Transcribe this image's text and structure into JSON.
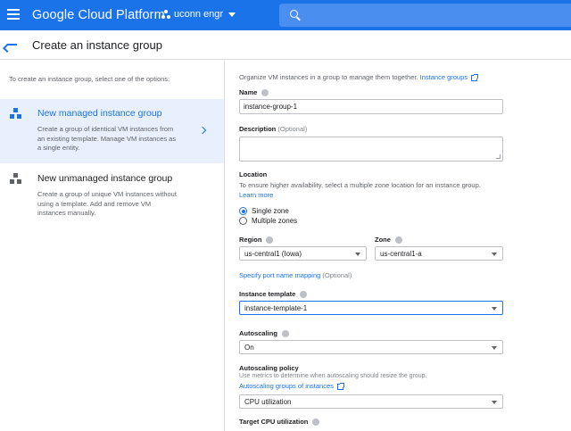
{
  "topbar": {
    "brand": "Google Cloud Platform",
    "project": "uconn engr",
    "search_placeholder": ""
  },
  "header": {
    "title": "Create an instance group"
  },
  "left": {
    "intro": "To create an instance group, select one of the options:",
    "options": [
      {
        "title": "New managed instance group",
        "description": "Create a group of identical VM instances from an existing template. Manage VM instances as a single entity."
      },
      {
        "title": "New unmanaged instance group",
        "description": "Create a group of unique VM instances without using a template. Add and remove VM instances manually."
      }
    ]
  },
  "form": {
    "intro": "Organize VM instances in a group to manage them together.",
    "intro_link": "Instance groups",
    "name_label": "Name",
    "name_value": "instance-group-1",
    "description_label": "Description",
    "description_optional": "(Optional)",
    "location_label": "Location",
    "location_help": "To ensure higher availability, select a multiple zone location for an instance group.",
    "learn_more": "Learn more",
    "single_zone": "Single zone",
    "multiple_zones": "Multiple zones",
    "region_label": "Region",
    "region_value": "us-central1 (Iowa)",
    "zone_label": "Zone",
    "zone_value": "us-central1-a",
    "port_mapping": "Specify port name mapping",
    "port_optional": "(Optional)",
    "template_label": "Instance template",
    "template_value": "instance-template-1",
    "autoscaling_label": "Autoscaling",
    "autoscaling_value": "On",
    "policy_label": "Autoscaling policy",
    "policy_help": "Use metrics to determine when autoscaling should resize the group.",
    "policy_link": "Autoscaling groups of instances",
    "policy_value": "CPU utilization",
    "target_cpu_label": "Target CPU utilization"
  },
  "colors": {
    "accent": "#1a73e8",
    "selected_bg": "#e8f0fe"
  }
}
